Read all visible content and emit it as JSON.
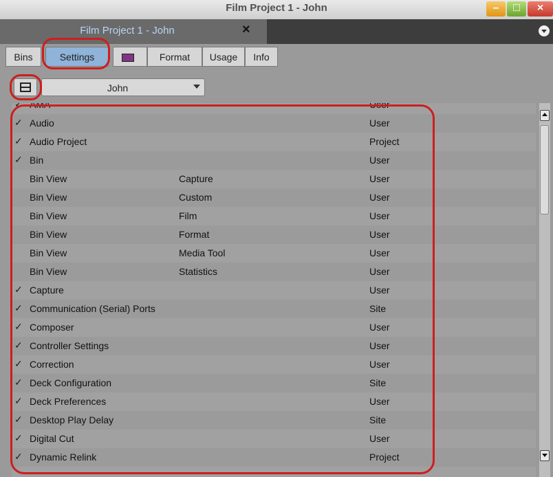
{
  "window": {
    "title": "Film Project 1 - John"
  },
  "project_tab": {
    "label": "Film Project 1 - John",
    "close_glyph": "×"
  },
  "subtabs": [
    {
      "label": "Bins",
      "active": false
    },
    {
      "label": "Settings",
      "active": true
    },
    {
      "label": "",
      "icon": "color-swatch-icon",
      "active": false
    },
    {
      "label": "Format",
      "active": false
    },
    {
      "label": "Usage",
      "active": false
    },
    {
      "label": "Info",
      "active": false
    }
  ],
  "settings_user": {
    "selected": "John"
  },
  "settings_list": {
    "rows": [
      {
        "checked": true,
        "name": "AMA",
        "sub": "",
        "scope": "User"
      },
      {
        "checked": true,
        "name": "Audio",
        "sub": "",
        "scope": "User"
      },
      {
        "checked": true,
        "name": "Audio Project",
        "sub": "",
        "scope": "Project"
      },
      {
        "checked": true,
        "name": "Bin",
        "sub": "",
        "scope": "User"
      },
      {
        "checked": false,
        "name": "Bin View",
        "sub": "Capture",
        "scope": "User"
      },
      {
        "checked": false,
        "name": "Bin View",
        "sub": "Custom",
        "scope": "User"
      },
      {
        "checked": false,
        "name": "Bin View",
        "sub": "Film",
        "scope": "User"
      },
      {
        "checked": false,
        "name": "Bin View",
        "sub": "Format",
        "scope": "User"
      },
      {
        "checked": false,
        "name": "Bin View",
        "sub": "Media Tool",
        "scope": "User"
      },
      {
        "checked": false,
        "name": "Bin View",
        "sub": "Statistics",
        "scope": "User"
      },
      {
        "checked": true,
        "name": "Capture",
        "sub": "",
        "scope": "User"
      },
      {
        "checked": true,
        "name": "Communication (Serial) Ports",
        "sub": "",
        "scope": "Site"
      },
      {
        "checked": true,
        "name": "Composer",
        "sub": "",
        "scope": "User"
      },
      {
        "checked": true,
        "name": "Controller Settings",
        "sub": "",
        "scope": "User"
      },
      {
        "checked": true,
        "name": "Correction",
        "sub": "",
        "scope": "User"
      },
      {
        "checked": true,
        "name": "Deck Configuration",
        "sub": "",
        "scope": "Site"
      },
      {
        "checked": true,
        "name": "Deck Preferences",
        "sub": "",
        "scope": "User"
      },
      {
        "checked": true,
        "name": "Desktop Play Delay",
        "sub": "",
        "scope": "Site"
      },
      {
        "checked": true,
        "name": "Digital Cut",
        "sub": "",
        "scope": "User"
      },
      {
        "checked": true,
        "name": "Dynamic Relink",
        "sub": "",
        "scope": "Project"
      }
    ]
  },
  "colors": {
    "highlight_ring": "#cf1d1d",
    "active_tab": "#8fb3d9",
    "tab_label": "#b8d4f2"
  }
}
